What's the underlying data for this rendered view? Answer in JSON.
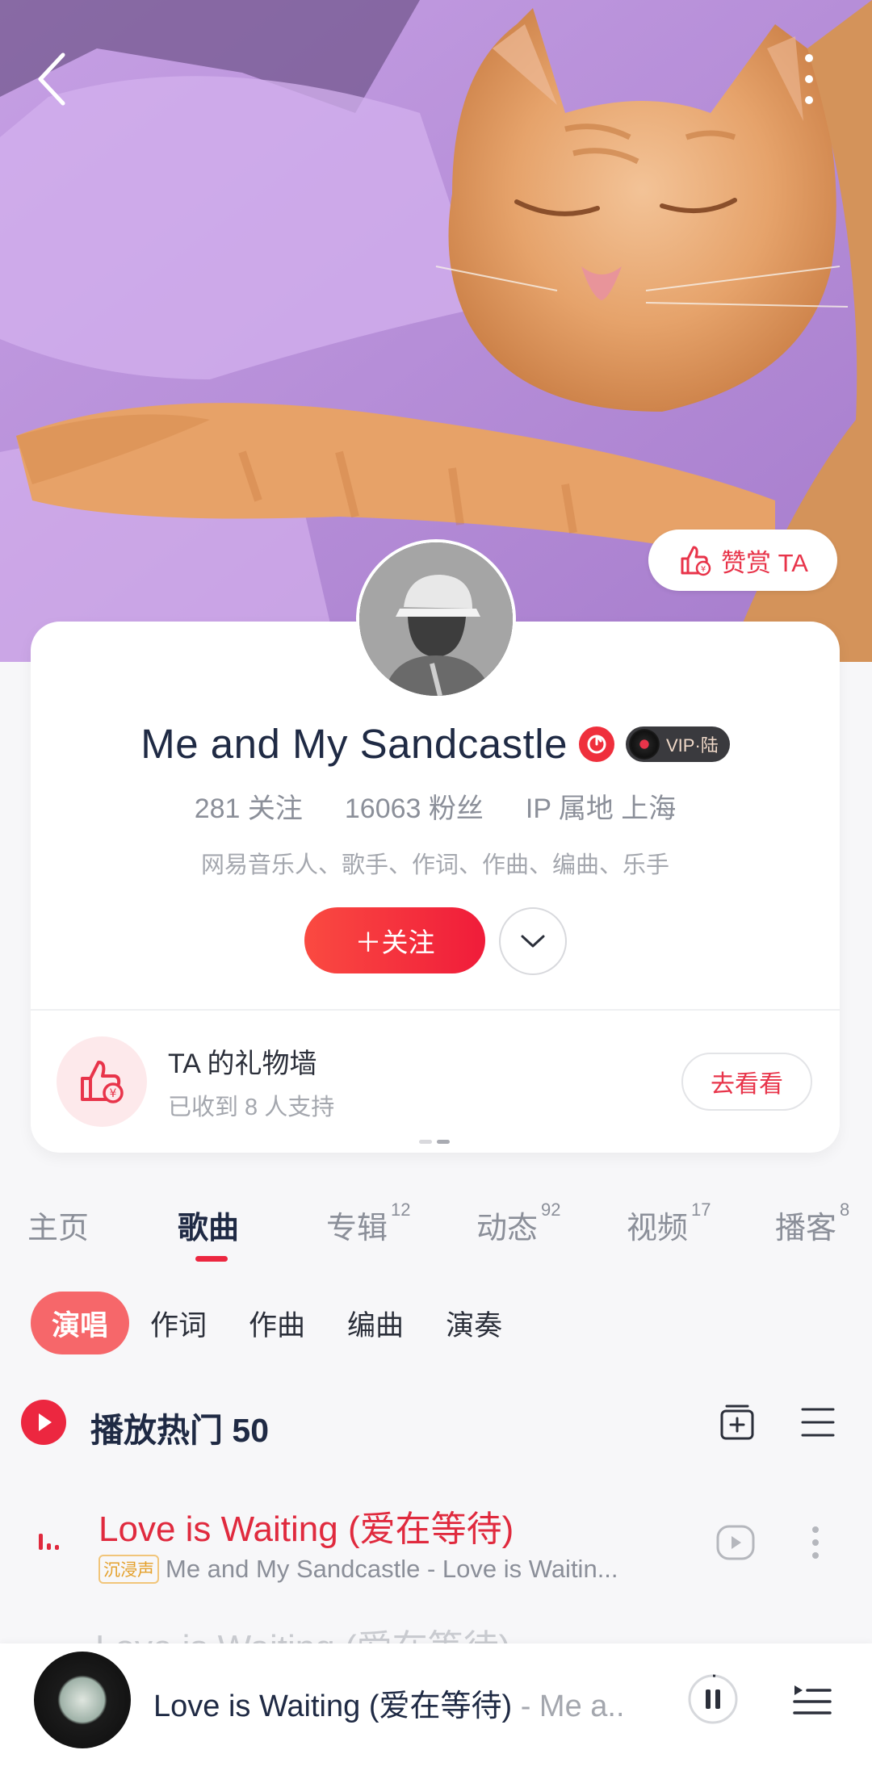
{
  "header": {
    "back_icon": "chevron-left-icon",
    "more_icon": "vertical-dots-icon",
    "reward_label": "赞赏 TA"
  },
  "profile": {
    "name": "Me and My Sandcastle",
    "vip_label": "VIP·陆",
    "following_count": "281",
    "following_label": "关注",
    "followers_count": "16063",
    "followers_label": "粉丝",
    "ip_label": "IP 属地 上海",
    "roles": "网易音乐人、歌手、作词、作曲、编曲、乐手",
    "follow_label": "＋关注"
  },
  "gift_wall": {
    "title": "TA 的礼物墙",
    "subtitle": "已收到 8 人支持",
    "button": "去看看"
  },
  "tabs": [
    {
      "label": "主页",
      "count": ""
    },
    {
      "label": "歌曲",
      "count": ""
    },
    {
      "label": "专辑",
      "count": "12"
    },
    {
      "label": "动态",
      "count": "92"
    },
    {
      "label": "视频",
      "count": "17"
    },
    {
      "label": "播客",
      "count": "8"
    }
  ],
  "filters": [
    "演唱",
    "作词",
    "作曲",
    "编曲",
    "演奏"
  ],
  "play_all": {
    "label": "播放热门 50"
  },
  "songs": [
    {
      "title": "Love is Waiting (爱在等待)",
      "tag": "沉浸声",
      "subtitle": "Me and My Sandcastle - Love is Waitin..."
    }
  ],
  "next_song_peek": "Love is Waiting (爱在等待)",
  "player": {
    "title": "Love is Waiting (爱在等待)",
    "artist": " - Me a..."
  },
  "colors": {
    "accent": "#ec2740",
    "reward_text": "#e8344a",
    "song_playing": "#e02a3e"
  }
}
